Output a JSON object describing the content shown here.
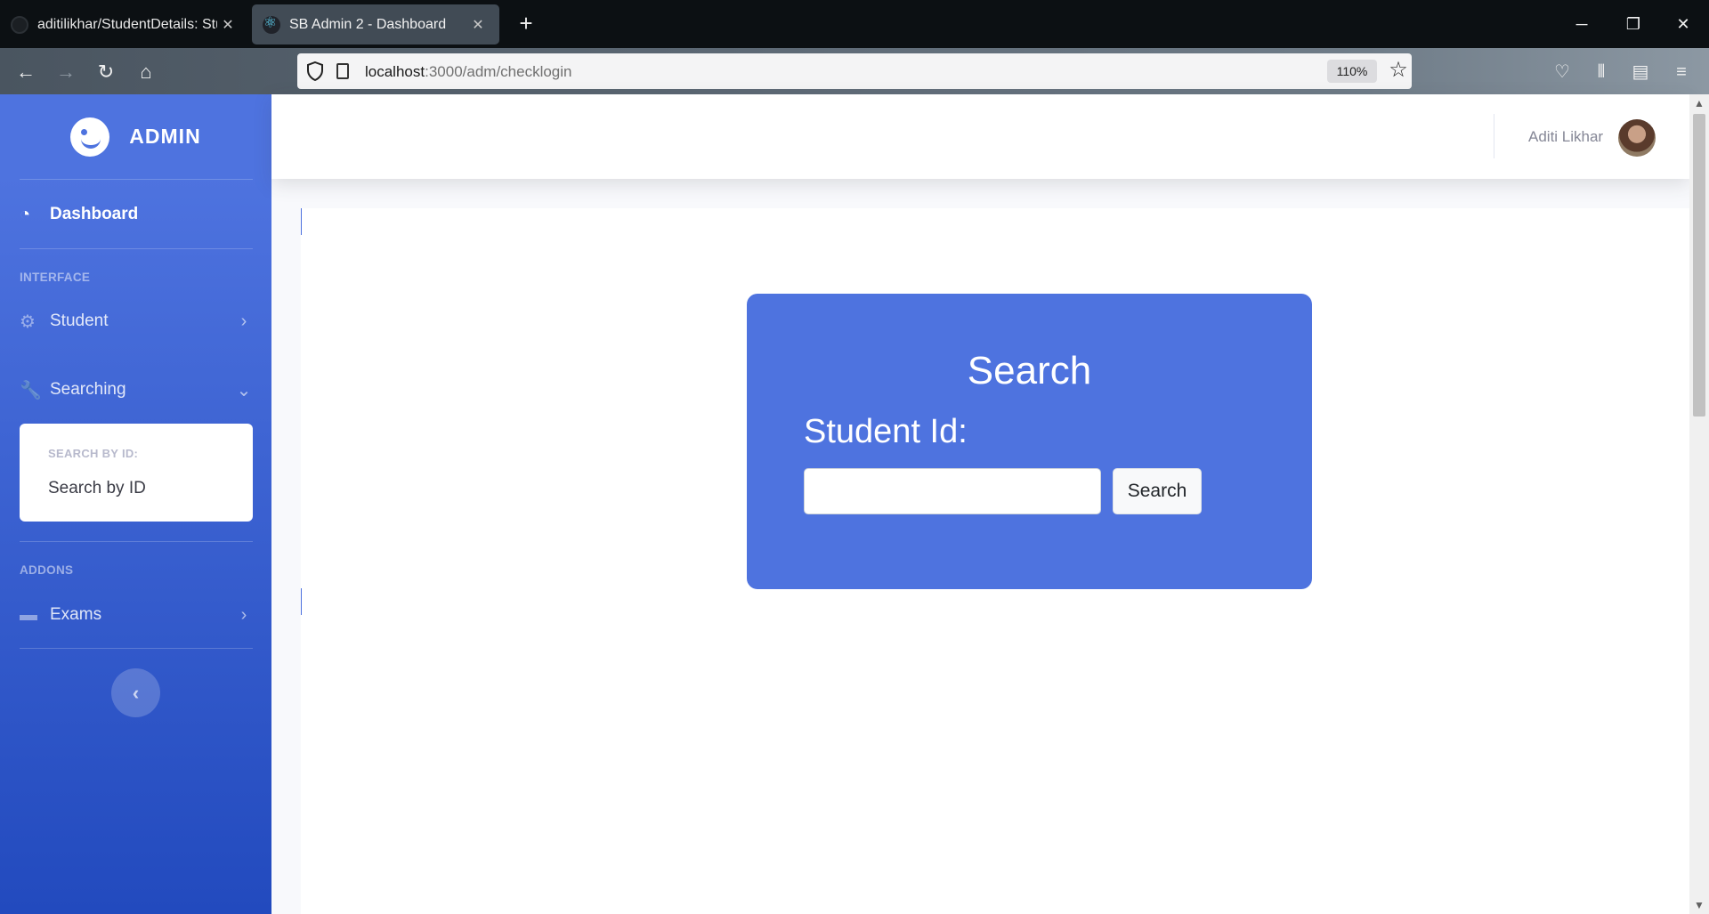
{
  "browser": {
    "tabs": [
      {
        "title": "aditilikhar/StudentDetails: Stude",
        "active": false
      },
      {
        "title": "SB Admin 2 - Dashboard",
        "active": true
      }
    ],
    "url_host": "localhost",
    "url_rest": ":3000/adm/checklogin",
    "zoom": "110%"
  },
  "sidebar": {
    "brand": "ADMIN",
    "dashboard": "Dashboard",
    "heading_interface": "INTERFACE",
    "student": "Student",
    "searching": "Searching",
    "collapse_heading": "SEARCH BY ID:",
    "collapse_item": "Search by ID",
    "heading_addons": "ADDONS",
    "exams": "Exams"
  },
  "topbar": {
    "user_name": "Aditi Likhar"
  },
  "search_card": {
    "title": "Search",
    "label": "Student Id:",
    "input_value": "",
    "button": "Search"
  },
  "colors": {
    "primary": "#4e73df",
    "primary_dark": "#224abe"
  }
}
